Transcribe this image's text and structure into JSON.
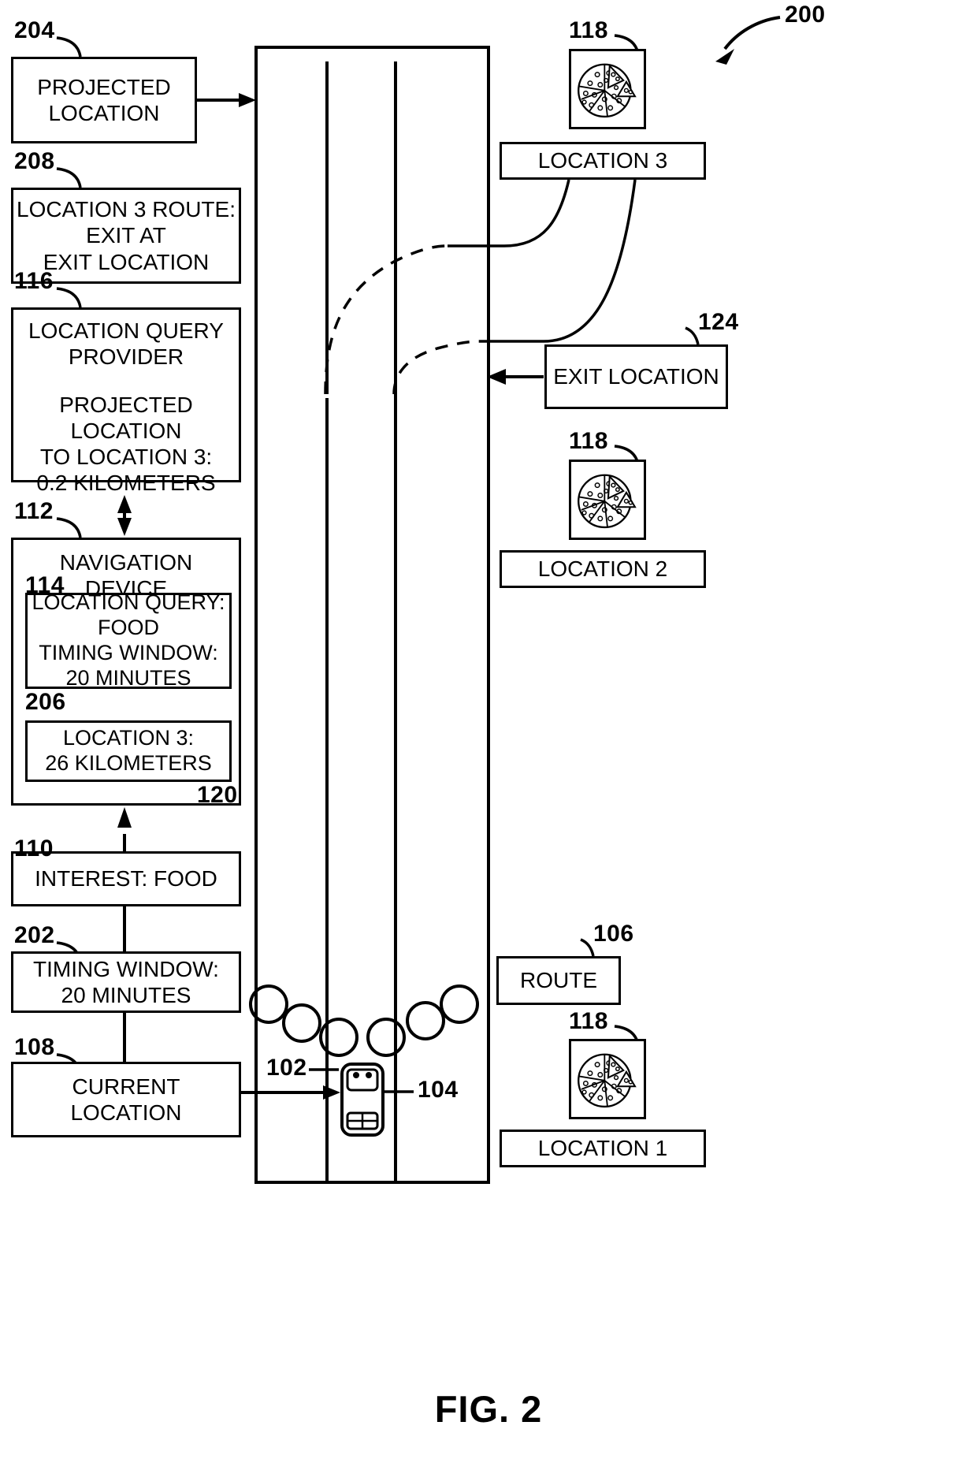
{
  "figure": {
    "label": "FIG. 2",
    "system_ref": "200"
  },
  "boxes": {
    "projected_location": {
      "ref": "204",
      "text": "PROJECTED\nLOCATION"
    },
    "location3_route": {
      "ref": "208",
      "text": "LOCATION 3 ROUTE:\nEXIT AT\nEXIT LOCATION"
    },
    "location_query_provider": {
      "ref": "116",
      "title": "LOCATION QUERY\nPROVIDER",
      "body": "PROJECTED\nLOCATION\nTO LOCATION 3:\n0.2 KILOMETERS"
    },
    "navigation_device": {
      "ref": "112",
      "title": "NAVIGATION DEVICE"
    },
    "location_query": {
      "ref": "114",
      "text": "LOCATION QUERY:\nFOOD\nTIMING WINDOW:\n20 MINUTES"
    },
    "location3_distance": {
      "ref": "206",
      "inner_ref": "120",
      "text": "LOCATION 3:\n26 KILOMETERS"
    },
    "interest": {
      "ref": "110",
      "text": "INTEREST: FOOD"
    },
    "timing_window": {
      "ref": "202",
      "text": "TIMING WINDOW:\n20 MINUTES"
    },
    "current_location": {
      "ref": "108",
      "text": "CURRENT\nLOCATION"
    },
    "location3": {
      "label": "LOCATION 3"
    },
    "location2": {
      "label": "LOCATION 2"
    },
    "location1": {
      "label": "LOCATION 1"
    },
    "exit_location": {
      "ref": "124",
      "label": "EXIT LOCATION"
    },
    "route": {
      "ref": "106",
      "label": "ROUTE"
    }
  },
  "icons": {
    "pizza_ref": "118",
    "pizza_name": "pizza-icon",
    "vehicle_ref": "102",
    "vehicle_detail_ref": "104"
  },
  "refs": {
    "r200": "200",
    "r204": "204",
    "r208": "208",
    "r116": "116",
    "r112": "112",
    "r114": "114",
    "r206": "206",
    "r120": "120",
    "r110": "110",
    "r202": "202",
    "r108": "108",
    "r118_top": "118",
    "r118_mid": "118",
    "r118_bot": "118",
    "r124": "124",
    "r106": "106",
    "r102": "102",
    "r104": "104"
  },
  "colors": {
    "line": "#000000",
    "background": "#ffffff"
  }
}
